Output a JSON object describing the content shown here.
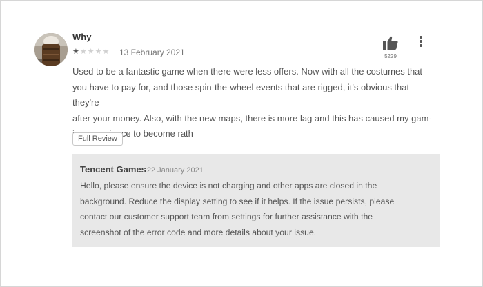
{
  "review": {
    "author": "Why",
    "rating": 1,
    "max_rating": 5,
    "date": "13 February 2021",
    "like_count": "5229",
    "text_lines": [
      "Used to be a fantastic game when there were less offers. Now with all the costumes that",
      "you have to pay for, and those spin-the-wheel events that are rigged, it's obvious that they're",
      "after your money. Also, with the new maps, there is more lag and this has caused my gam-",
      "ing experience to become rath"
    ],
    "full_review_label": "Full Review"
  },
  "reply": {
    "author": "Tencent Games",
    "date": "22 January 2021",
    "text_lines": [
      "Hello, please ensure the device is not charging and other apps are closed in the",
      "background. Reduce the display setting to see if it helps. If the issue persists, please",
      "contact our customer support team from settings for further assistance with the",
      "screenshot of the error code and more details about your issue."
    ]
  },
  "icons": {
    "like": "thumbs-up-icon",
    "more": "more-vert-icon",
    "star": "star-icon"
  },
  "colors": {
    "reply_background": "#e8e8e8",
    "star_filled": "#555555",
    "star_empty": "#cfcfcf"
  }
}
